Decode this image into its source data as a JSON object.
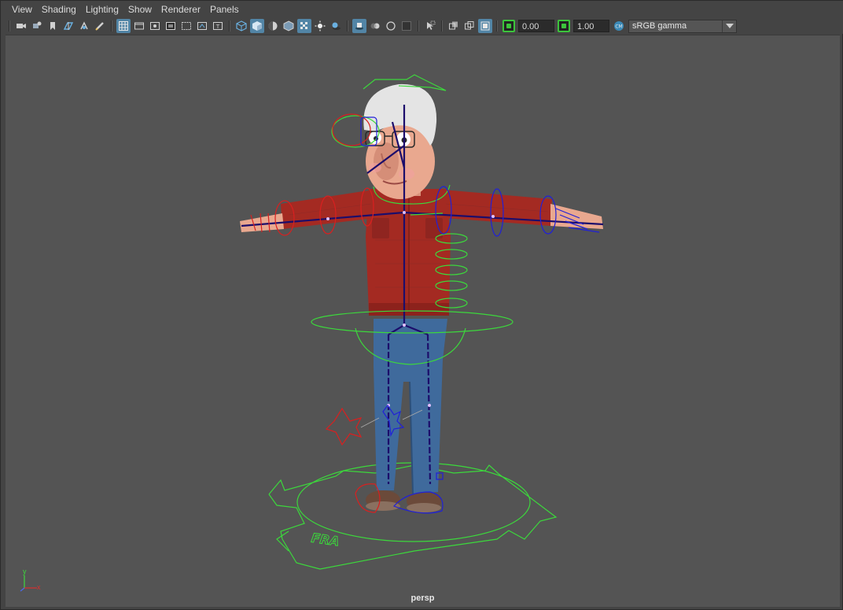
{
  "menu": {
    "items": [
      "View",
      "Shading",
      "Lighting",
      "Show",
      "Renderer",
      "Panels"
    ]
  },
  "toolbar": {
    "exposure_value": "0.00",
    "gamma_value": "1.00",
    "color_space": "sRGB gamma",
    "icons": [
      "select-camera-icon",
      "camera-attributes-icon",
      "bookmark-icon",
      "image-plane-icon",
      "2d-pan-zoom-icon",
      "grease-pencil-icon",
      "grid-icon",
      "film-gate-icon",
      "resolution-gate-icon",
      "gate-mask-icon",
      "field-chart-icon",
      "safe-action-icon",
      "safe-title-icon",
      "wireframe-icon",
      "smooth-shade-icon",
      "default-material-icon",
      "wireframe-on-shaded-icon",
      "textured-icon",
      "use-all-lights-icon",
      "shadows-icon",
      "screen-space-ao-icon",
      "motion-blur-icon",
      "multisample-aa-icon",
      "depth-of-field-icon",
      "isolate-select-icon",
      "xray-icon",
      "xray-joints-icon",
      "xray-active-icon",
      "exposure-icon",
      "gamma-icon",
      "color-management-icon"
    ]
  },
  "viewport": {
    "camera_label": "persp",
    "floor_text": "FRA",
    "axis_y": "y",
    "axis_x": "x",
    "colors": {
      "background": "#545454",
      "nurbs_control": "#3cd83c",
      "left_control": "#d82020",
      "right_control": "#2020d8",
      "joint": "#1c0d6b",
      "shirt": "#a42a22",
      "jeans": "#3f6a9c",
      "skin": "#e9a88f",
      "hair": "#e4e4e4"
    }
  }
}
